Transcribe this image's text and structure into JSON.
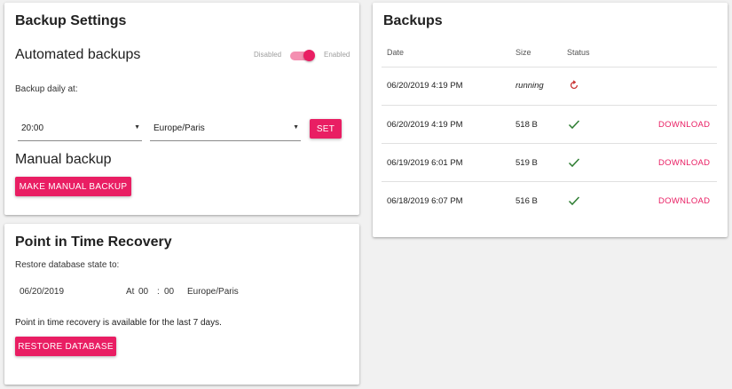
{
  "backup_settings": {
    "title": "Backup Settings",
    "automated_label": "Automated backups",
    "toggle_disabled_label": "Disabled",
    "toggle_enabled_label": "Enabled",
    "toggle_state": "enabled",
    "daily_label": "Backup daily at:",
    "time_select": "20:00",
    "timezone_select": "Europe/Paris",
    "set_button": "SET",
    "manual_title": "Manual backup",
    "manual_button": "MAKE MANUAL BACKUP"
  },
  "pitr": {
    "title": "Point in Time Recovery",
    "restore_label": "Restore database state to:",
    "date": "06/20/2019",
    "at_label": "At",
    "hour": "00",
    "colon": ":",
    "minute": "00",
    "timezone": "Europe/Paris",
    "note": "Point in time recovery is available for the last 7 days.",
    "restore_button": "RESTORE DATABASE"
  },
  "backups": {
    "title": "Backups",
    "columns": {
      "date": "Date",
      "size": "Size",
      "status": "Status"
    },
    "rows": [
      {
        "date": "06/20/2019 4:19 PM",
        "size": "running",
        "status_icon": "refresh-icon",
        "action": ""
      },
      {
        "date": "06/20/2019 4:19 PM",
        "size": "518 B",
        "status_icon": "check-icon",
        "action": "DOWNLOAD"
      },
      {
        "date": "06/19/2019 6:01 PM",
        "size": "519 B",
        "status_icon": "check-icon",
        "action": "DOWNLOAD"
      },
      {
        "date": "06/18/2019 6:07 PM",
        "size": "516 B",
        "status_icon": "check-icon",
        "action": "DOWNLOAD"
      }
    ]
  },
  "colors": {
    "accent": "#e91e63",
    "accent_light": "#f48fb1",
    "success": "#2e7d32",
    "running": "#c62828"
  }
}
